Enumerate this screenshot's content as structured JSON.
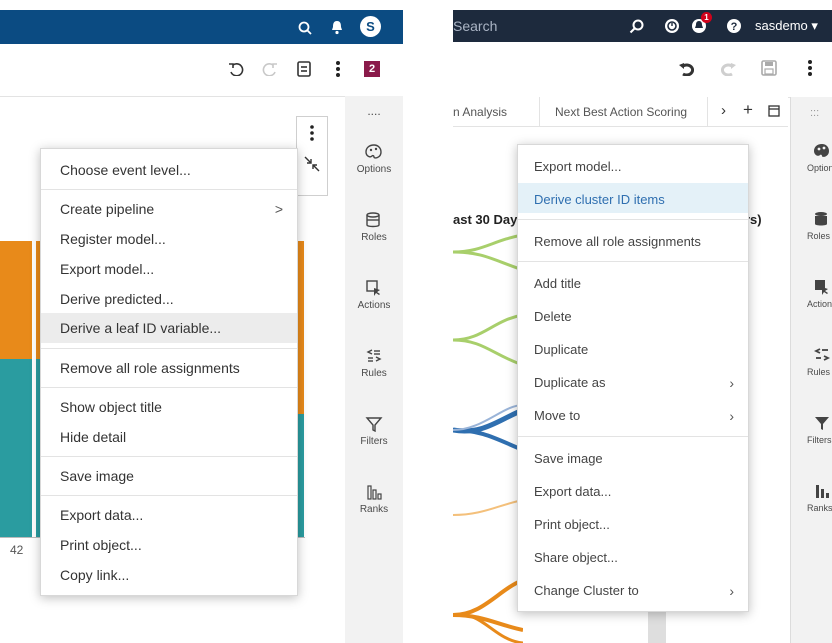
{
  "left": {
    "header": {
      "avatar_letter": "S"
    },
    "toolbar": {
      "badge": "2"
    },
    "axis_label": "42",
    "menu": {
      "items": [
        {
          "label": "Choose event level..."
        },
        {
          "label": "Create pipeline"
        },
        {
          "label": "Register model..."
        },
        {
          "label": "Export model..."
        },
        {
          "label": "Derive predicted..."
        },
        {
          "label": "Derive a leaf ID variable..."
        },
        {
          "label": "Remove all role assignments"
        },
        {
          "label": "Show object title"
        },
        {
          "label": "Hide detail"
        },
        {
          "label": "Save image"
        },
        {
          "label": "Export data..."
        },
        {
          "label": "Print object..."
        },
        {
          "label": "Copy link..."
        }
      ]
    },
    "rail": {
      "more": "....",
      "items": [
        {
          "label": "Options",
          "icon": "palette-icon"
        },
        {
          "label": "Roles",
          "icon": "roles-icon"
        },
        {
          "label": "Actions",
          "icon": "cursor-icon"
        },
        {
          "label": "Rules",
          "icon": "rules-icon"
        },
        {
          "label": "Filters",
          "icon": "filter-icon"
        },
        {
          "label": "Ranks",
          "icon": "ranks-icon"
        }
      ]
    }
  },
  "right": {
    "header": {
      "search_placeholder": "Search",
      "notification_count": "1",
      "user": "sasdemo ▾"
    },
    "tabs": [
      {
        "label": "n Analysis"
      },
      {
        "label": "Next Best Action Scoring"
      }
    ],
    "chart_title_fragment": "ast 30 Day",
    "chart_title_fragment2": "rs)",
    "menu": {
      "items": [
        {
          "label": "Export model..."
        },
        {
          "label": "Derive cluster ID items"
        },
        {
          "label": "Remove all role assignments"
        },
        {
          "label": "Add title"
        },
        {
          "label": "Delete"
        },
        {
          "label": "Duplicate"
        },
        {
          "label": "Duplicate as"
        },
        {
          "label": "Move to"
        },
        {
          "label": "Save image"
        },
        {
          "label": "Export data..."
        },
        {
          "label": "Print object..."
        },
        {
          "label": "Share object..."
        },
        {
          "label": "Change Cluster to"
        }
      ]
    },
    "rail": {
      "more": ":::",
      "items": [
        {
          "label": "Option",
          "icon": "palette-icon"
        },
        {
          "label": "Roles",
          "icon": "roles-icon"
        },
        {
          "label": "Action",
          "icon": "cursor-icon"
        },
        {
          "label": "Rules",
          "icon": "rules-icon"
        },
        {
          "label": "Filters",
          "icon": "filter-icon"
        },
        {
          "label": "Ranks",
          "icon": "ranks-icon"
        }
      ]
    }
  },
  "colors": {
    "left_header": "#0b4b82",
    "right_header": "#1d2a3d",
    "orange": "#e88a1a",
    "teal": "#2a9ca0",
    "highlight": "#e4f1f8",
    "badge": "#8a1a4a"
  }
}
